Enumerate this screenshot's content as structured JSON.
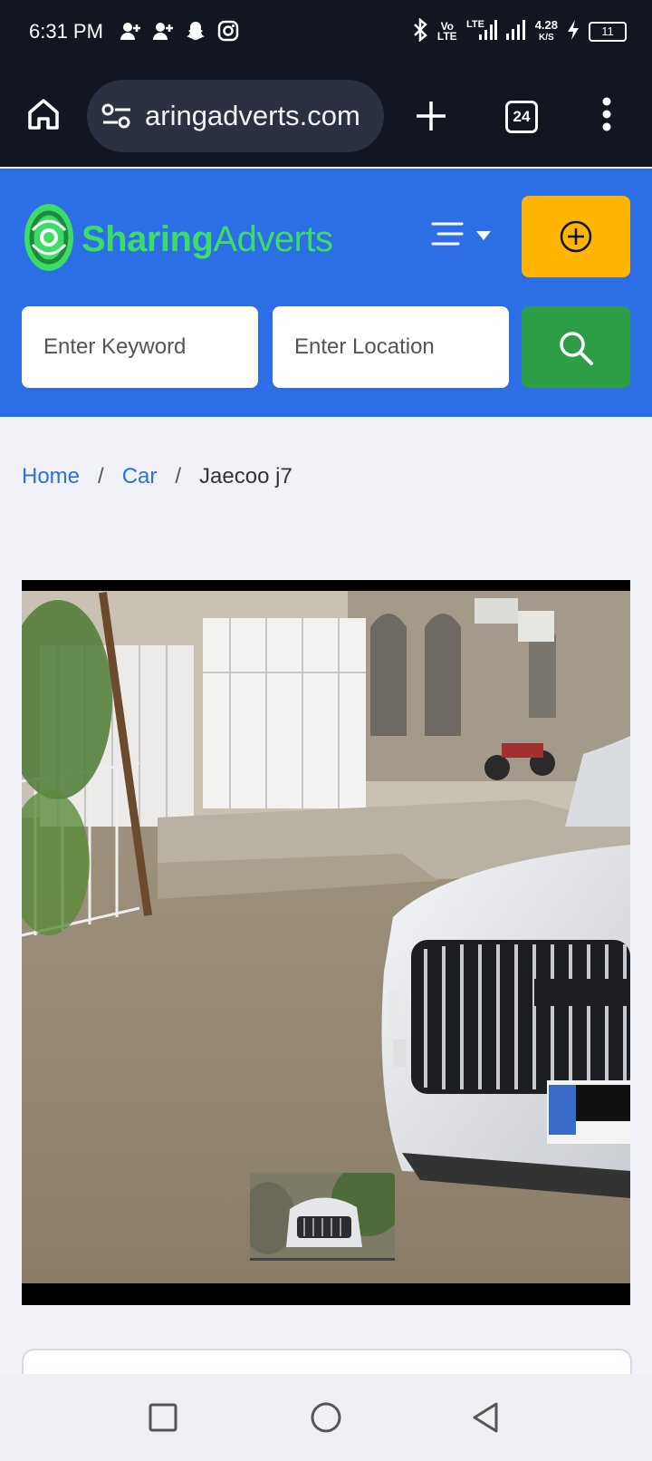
{
  "status_bar": {
    "time": "6:31 PM",
    "net_speed_value": "4.28",
    "net_speed_unit": "K/S",
    "battery": "11",
    "icons": [
      "person-add-icon",
      "person-add-icon",
      "snapchat-icon",
      "instagram-icon",
      "bluetooth-icon",
      "volte-icon",
      "lte-signal-icon",
      "signal-icon",
      "charging-icon",
      "battery-icon"
    ]
  },
  "browser": {
    "url": "aringadverts.com",
    "tab_count": "24",
    "icons": [
      "home-icon",
      "site-settings-icon",
      "new-tab-icon",
      "tabs-icon",
      "more-menu-icon"
    ]
  },
  "site": {
    "logo_part1": "Sharing",
    "logo_part2": "Adverts",
    "colors": {
      "header": "#2b6ee6",
      "logo": "#3ddc66",
      "post_button": "#ffb400",
      "search_button": "#2e9e46"
    },
    "search": {
      "keyword_placeholder": "Enter Keyword",
      "location_placeholder": "Enter Location"
    }
  },
  "breadcrumb": {
    "home": "Home",
    "category": "Car",
    "current": "Jaecoo j7",
    "separator": "/"
  },
  "gallery": {
    "main_image": "white Jaecoo J7 SUV parked on a street beside white gates",
    "thumbnail": "car-thumbnail"
  },
  "android_nav": [
    "recents-icon",
    "home-circle-icon",
    "back-icon"
  ]
}
